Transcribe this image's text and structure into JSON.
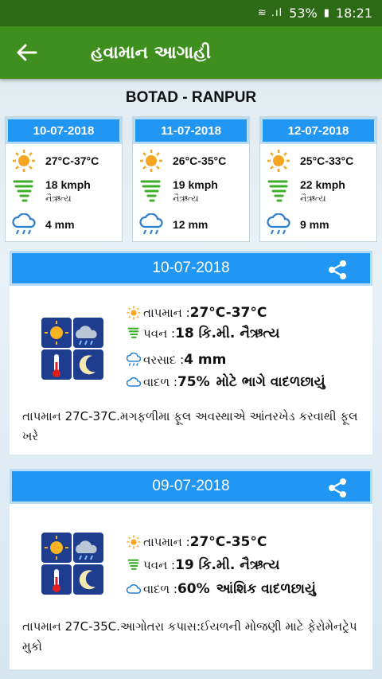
{
  "status": {
    "battery": "53%",
    "time": "18:21"
  },
  "appbar": {
    "title": "હવામાન આગાહી"
  },
  "location": "BOTAD - RANPUR",
  "forecast": [
    {
      "date": "10-07-2018",
      "temp": "27°C-37°C",
      "wind": "18 kmph",
      "dir": "નૈઋત્ય",
      "rain": "4 mm"
    },
    {
      "date": "11-07-2018",
      "temp": "26°C-35°C",
      "wind": "19 kmph",
      "dir": "નૈઋત્ય",
      "rain": "12 mm"
    },
    {
      "date": "12-07-2018",
      "temp": "25°C-33°C",
      "wind": "22 kmph",
      "dir": "નૈઋત્ય",
      "rain": "9 mm"
    }
  ],
  "details": [
    {
      "date": "10-07-2018",
      "temp_label": "તાપમાન :",
      "temp": "27°C-37°C",
      "wind_label": "પવન :",
      "wind": "18 કિ.મી. નૈઋત્ય",
      "rain_label": "વરસાદ :",
      "rain": "4 mm",
      "cloud_label": "વાદળ :",
      "cloud": "75%",
      "cloud_desc": "મોટે ભાગે વાદળછાયું",
      "advice": "તાપમાન 27C-37C.મગફળીમા ફૂલ અવસ્થાએ આંતરખેડ કરવાથી ફૂલ ખરે"
    },
    {
      "date": "09-07-2018",
      "temp_label": "તાપમાન :",
      "temp": "27°C-35°C",
      "wind_label": "પવન :",
      "wind": "19 કિ.મી. નૈઋત્ય",
      "cloud_label": "વાદળ :",
      "cloud": "60%",
      "cloud_desc": "આંશિક વાદળછાયું",
      "advice": "તાપમાન 27C-35C.આગોતરા કપાસ:ઈયળની મોજણી માટે ફેરોમેનટ્રેપ મુકો"
    }
  ],
  "colors": {
    "appbar": "#3e8f1e",
    "statusbar": "#2d6a15",
    "header": "#2196f3",
    "sun": "#f5a623",
    "wind": "#3fae2a",
    "rain": "#2a7fd4"
  },
  "icons": [
    "back-arrow-icon",
    "sun-icon",
    "wind-icon",
    "rain-cloud-icon",
    "share-icon",
    "cloud-icon",
    "weather-grid-icon"
  ]
}
